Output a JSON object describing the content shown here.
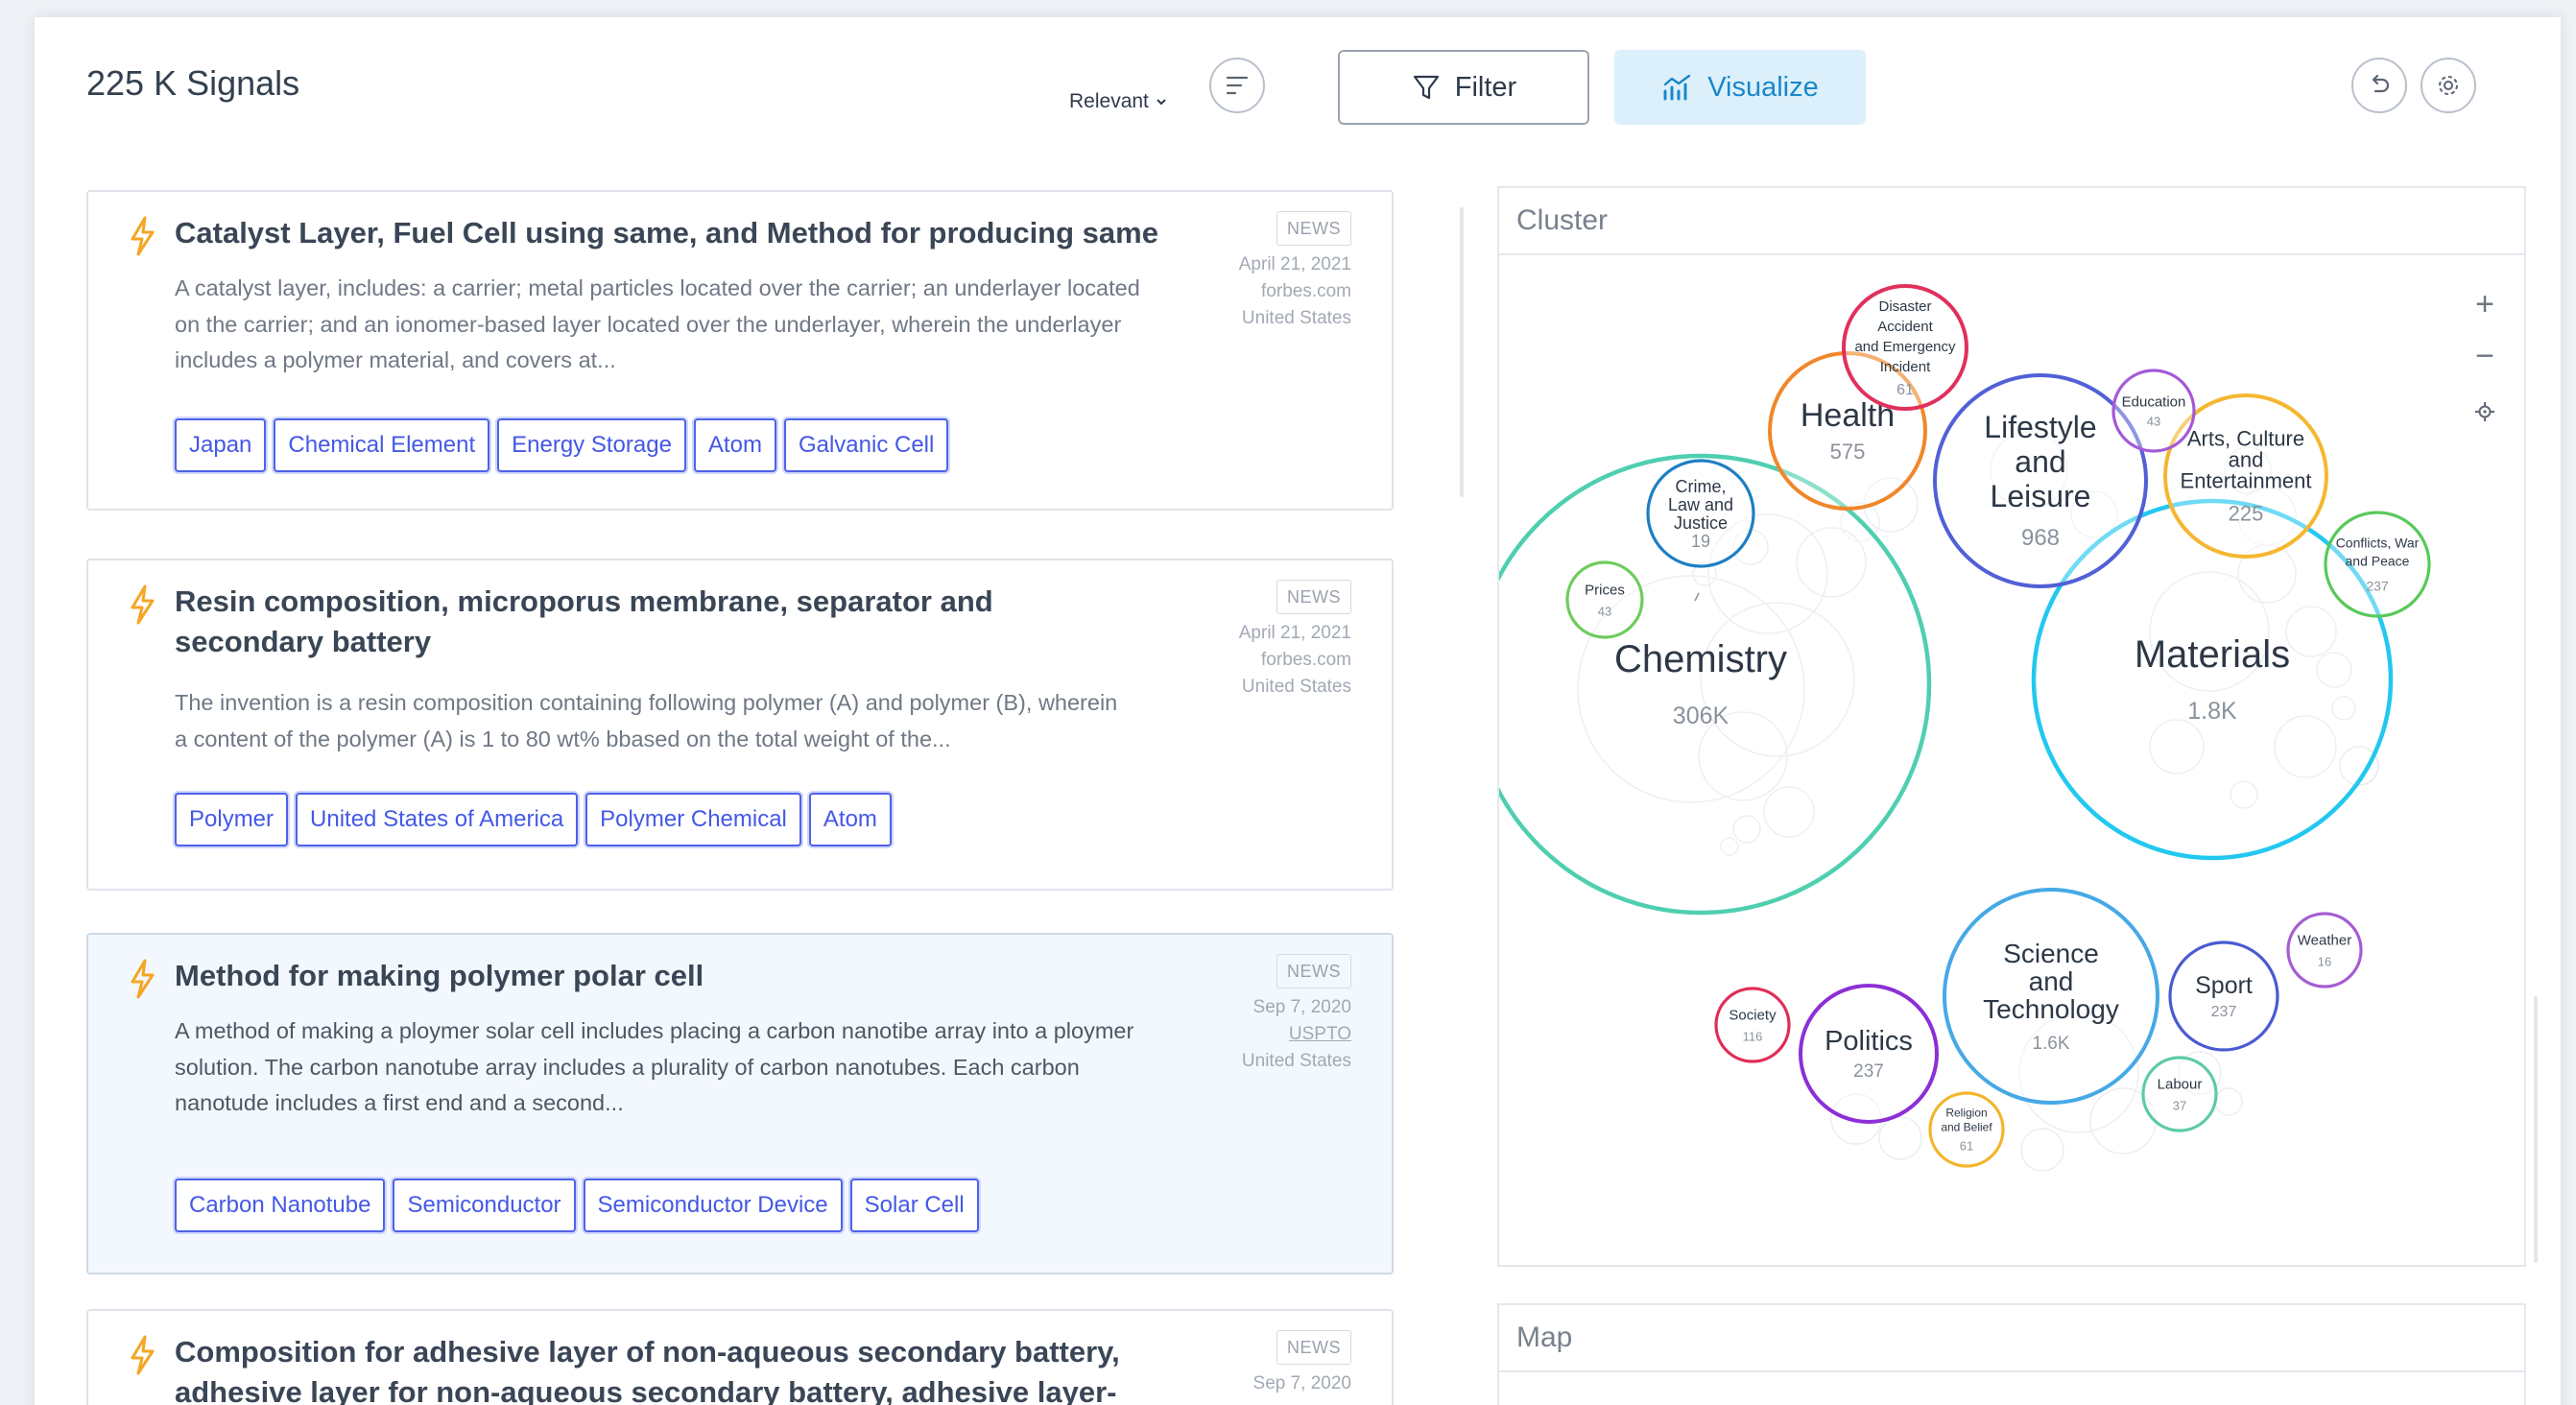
{
  "header": {
    "title": "225 K Signals",
    "sort_label": "Relevant",
    "filter_label": "Filter",
    "visualize_label": "Visualize"
  },
  "cards": [
    {
      "title": "Catalyst Layer, Fuel Cell using same, and Method for producing same",
      "excerpt": "A catalyst layer, includes: a carrier; metal particles located over the carrier; an underlayer located on the carrier; and an ionomer-based layer located over the underlayer, wherein the underlayer includes a polymer material, and covers at...",
      "type": "NEWS",
      "date": "April 21, 2021",
      "source": "forbes.com",
      "country": "United States",
      "tags": [
        "Japan",
        "Chemical Element",
        "Energy Storage",
        "Atom",
        "Galvanic Cell"
      ]
    },
    {
      "title": "Resin composition, microporus membrane, separator and secondary battery",
      "excerpt": "The invention is a resin composition containing following polymer (A) and polymer (B), wherein a content of the polymer (A) is 1 to 80 wt% bbased on the total weight of the...",
      "type": "NEWS",
      "date": "April 21, 2021",
      "source": "forbes.com",
      "country": "United States",
      "tags": [
        "Polymer",
        "United States of America",
        "Polymer Chemical",
        "Atom"
      ]
    },
    {
      "title": "Method for making polymer polar cell",
      "excerpt": "A method of making a ploymer solar cell includes placing a carbon nanotibe array into a ploymer solution. The carbon nanotube array includes a plurality of carbon nanotubes. Each carbon nanotude includes a first end and a second...",
      "type": "NEWS",
      "date": "Sep 7, 2020",
      "source": "USPTO",
      "country": "United States",
      "tags": [
        "Carbon Nanotube",
        "Semiconductor",
        "Semiconductor Device",
        "Solar Cell"
      ]
    },
    {
      "title": "Composition for adhesive layer of non-aqueous secondary battery, adhesive layer for non-aqueous secondary battery, adhesive layer-",
      "type": "NEWS",
      "date": "Sep 7, 2020"
    }
  ],
  "cluster_panel": {
    "title": "Cluster",
    "zoom_in": "+",
    "zoom_out": "−",
    "bubbles": [
      {
        "id": "chemistry",
        "lines": [
          "Chemistry"
        ],
        "count": "306K",
        "color": "#4fcfb0"
      },
      {
        "id": "materials",
        "lines": [
          "Materials"
        ],
        "count": "1.8K",
        "color": "#22c8ef"
      },
      {
        "id": "lifestyle",
        "lines": [
          "Lifestyle",
          "and",
          "Leisure"
        ],
        "count": "968",
        "color": "#5160d6"
      },
      {
        "id": "health",
        "lines": [
          "Health"
        ],
        "count": "575",
        "color": "#f0872a"
      },
      {
        "id": "arts",
        "lines": [
          "Arts, Culture",
          "and",
          "Entertainment"
        ],
        "count": "225",
        "color": "#f5b731"
      },
      {
        "id": "science",
        "lines": [
          "Science",
          "and",
          "Technology"
        ],
        "count": "1.6K",
        "color": "#46a9e6"
      },
      {
        "id": "politics",
        "lines": [
          "Politics"
        ],
        "count": "237",
        "color": "#8c2fd6"
      },
      {
        "id": "sport",
        "lines": [
          "Sport"
        ],
        "count": "237",
        "color": "#4a5ad0"
      },
      {
        "id": "crime",
        "lines": [
          "Crime,",
          "Law and",
          "Justice"
        ],
        "count": "19",
        "color": "#1d7fc4"
      },
      {
        "id": "disaster",
        "lines": [
          "Disaster",
          "Accident",
          "and Emergency",
          "Incident"
        ],
        "count": "61",
        "color": "#e0305c"
      },
      {
        "id": "education",
        "lines": [
          "Education"
        ],
        "count": "43",
        "color": "#a559d8"
      },
      {
        "id": "conflicts",
        "lines": [
          "Conflicts, War",
          "and Peace"
        ],
        "count": "237",
        "color": "#58c95a"
      },
      {
        "id": "prices",
        "lines": [
          "Prices"
        ],
        "count": "43",
        "color": "#6dcc5c"
      },
      {
        "id": "weather",
        "lines": [
          "Weather"
        ],
        "count": "16",
        "color": "#a65cd4"
      },
      {
        "id": "society",
        "lines": [
          "Society"
        ],
        "count": "116",
        "color": "#e02d58"
      },
      {
        "id": "labour",
        "lines": [
          "Labour"
        ],
        "count": "37",
        "color": "#5ccaa8"
      },
      {
        "id": "religion",
        "lines": [
          "Religion",
          "and Belief"
        ],
        "count": "61",
        "color": "#f3b52c"
      }
    ]
  },
  "map_panel": {
    "title": "Map"
  },
  "colors": {
    "accent": "#4458e6",
    "visualize_bg": "#dcf0fb",
    "visualize_text": "#1a87c9",
    "bolt": "#f5a623"
  }
}
